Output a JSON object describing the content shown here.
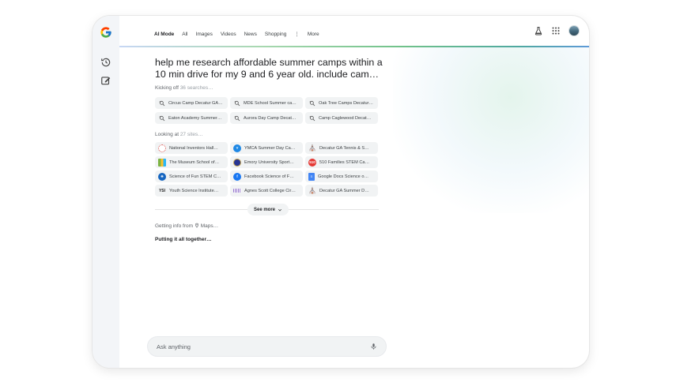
{
  "nav": {
    "tabs": [
      "AI Mode",
      "All",
      "Images",
      "Videos",
      "News",
      "Shopping"
    ],
    "more_label": "More"
  },
  "query": "help me research affordable summer camps within a 10 min drive for my 9 and 6 year old. include cam…",
  "searches": {
    "prefix": "Kicking off",
    "count_text": "36 searches…",
    "pills": [
      "Circus Camp Decatur GA…",
      "MDE School Summer ca…",
      "Oak Tree Camps Decatur…",
      "Eaton Academy Summer…",
      "Aurora Day Camp Decat…",
      "Camp Caglewood Decat…"
    ]
  },
  "sites": {
    "prefix": "Looking at",
    "count_text": "27 sites…",
    "items": [
      {
        "label": "National Inventors Hall…",
        "icon": "inventors-hall-favicon",
        "color": "#d9534f"
      },
      {
        "label": "YMCA Summer Day Ca…",
        "icon": "ymca-favicon",
        "color": "#1e88e5"
      },
      {
        "label": "Decatur GA  Tennis & S…",
        "icon": "decatur-ga-favicon",
        "color": "#8d6e63"
      },
      {
        "label": "The Museum School  of…",
        "icon": "museum-school-favicon",
        "color": "#7cb342"
      },
      {
        "label": "Emory University  Sport…",
        "icon": "emory-favicon",
        "color": "#283593"
      },
      {
        "label": "510 Families  STEM Ca…",
        "icon": "510-families-favicon",
        "color": "#e53935"
      },
      {
        "label": "Science of Fun  STEM C…",
        "icon": "science-of-fun-favicon",
        "color": "#1565c0"
      },
      {
        "label": "Facebook  Science of F…",
        "icon": "facebook-favicon",
        "color": "#1877f2"
      },
      {
        "label": "Google Docs  Science o…",
        "icon": "google-docs-favicon",
        "color": "#4285f4"
      },
      {
        "label": "Youth Science Institute…",
        "icon": "youth-science-favicon",
        "color": "#212121"
      },
      {
        "label": "Agnes Scott College  Cir…",
        "icon": "agnes-scott-favicon",
        "color": "#9575cd"
      },
      {
        "label": "Decatur GA  Summer D…",
        "icon": "decatur-ga-favicon",
        "color": "#8d6e63"
      }
    ]
  },
  "see_more_label": "See more",
  "info": {
    "prefix": "Getting info from",
    "source": "Maps…"
  },
  "status": "Putting it all together…",
  "askbar": {
    "placeholder": "Ask anything"
  },
  "colors": {
    "accent_green": "#71c28a",
    "pill_bg": "#f1f3f4"
  }
}
